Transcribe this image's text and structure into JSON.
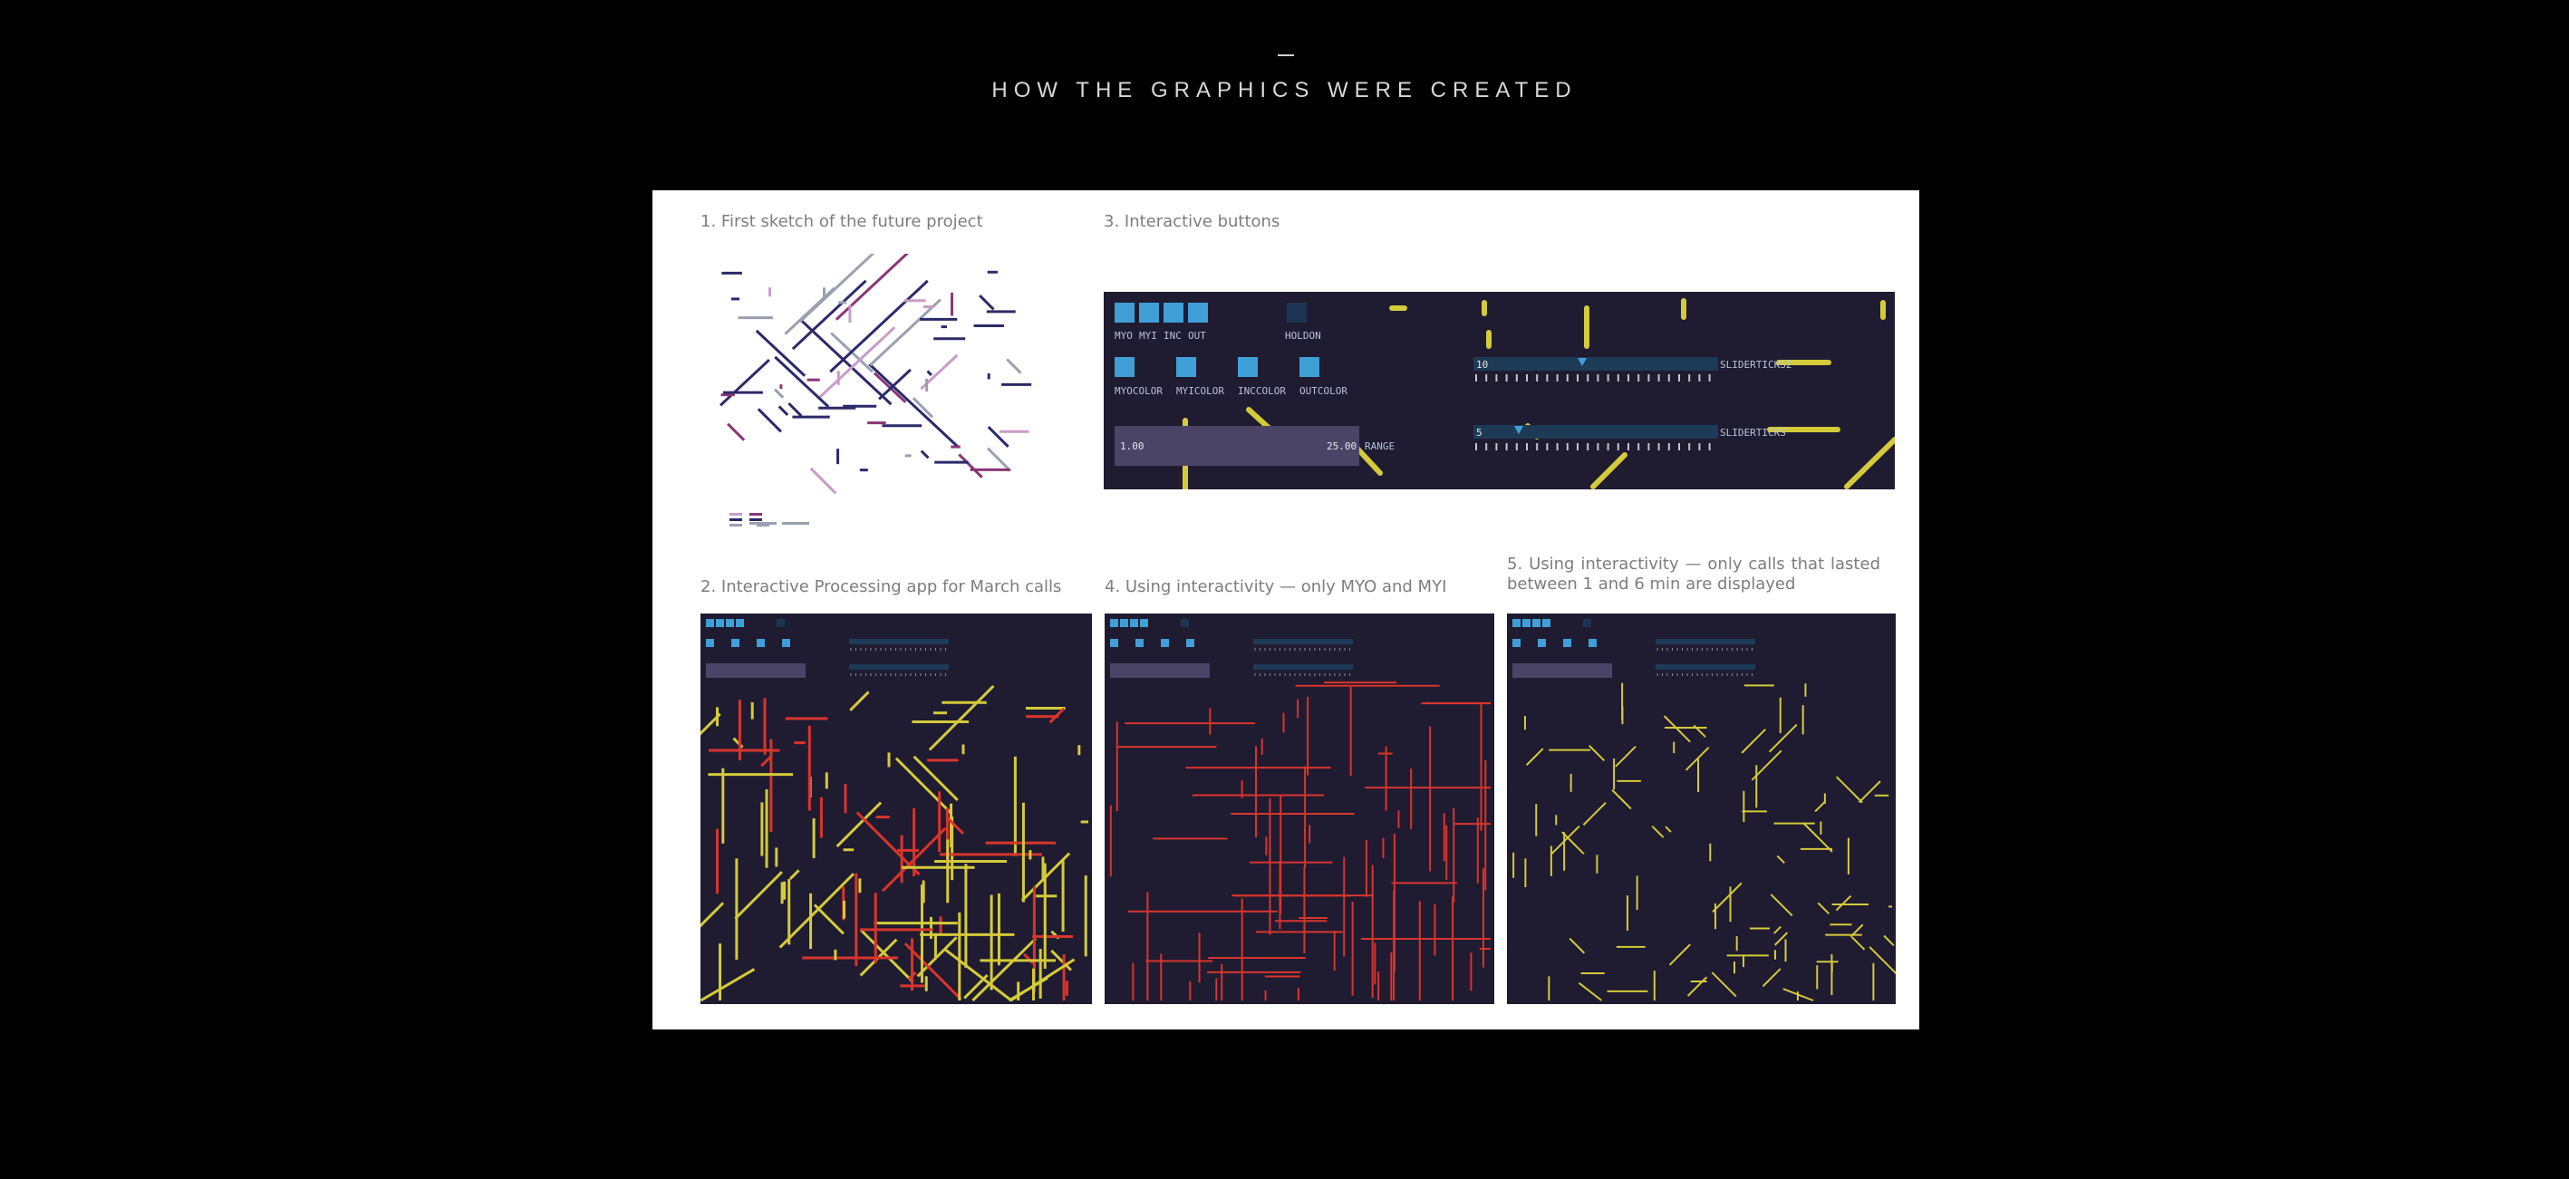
{
  "page": {
    "heading": "HOW THE GRAPHICS WERE CREATED",
    "heading_mark": "—"
  },
  "colors": {
    "background": "#000000",
    "panel": "#ffffff",
    "frame": "#1f1b31",
    "yellow": "#d4cb3a",
    "red": "#d8352c",
    "blue": "#3f9fd6",
    "navy": "#2b2a6a",
    "pink": "#c99bc8",
    "purple": "#8a3576",
    "gray": "#9aa0b0"
  },
  "steps": [
    {
      "number": "1.",
      "caption": "1. First sketch of the future project"
    },
    {
      "number": "2.",
      "caption": "2.  Interactive Processing app for March calls"
    },
    {
      "number": "3.",
      "caption": "3. Interactive buttons"
    },
    {
      "number": "4.",
      "caption": "4. Using interactivity — only MYO and MYI"
    },
    {
      "number": "5.",
      "caption": "5. Using interactivity — only calls that lasted between 1 and 6 min are displayed"
    }
  ],
  "controls": {
    "toggle_labels": [
      "MYO",
      "MYI",
      "INC",
      "OUT"
    ],
    "holdon_label": "HOLDON",
    "color_labels": [
      "MYOCOLOR",
      "MYICOLOR",
      "INCCOLOR",
      "OUTCOLOR"
    ],
    "range": {
      "min_label": "1.00",
      "max_label": "25.00",
      "name": "RANGE"
    },
    "slider_top": {
      "value_label": "10",
      "name": "SLIDERTICKS2"
    },
    "slider_bottom": {
      "value_label": "5",
      "name": "SLIDERTICKS"
    }
  }
}
